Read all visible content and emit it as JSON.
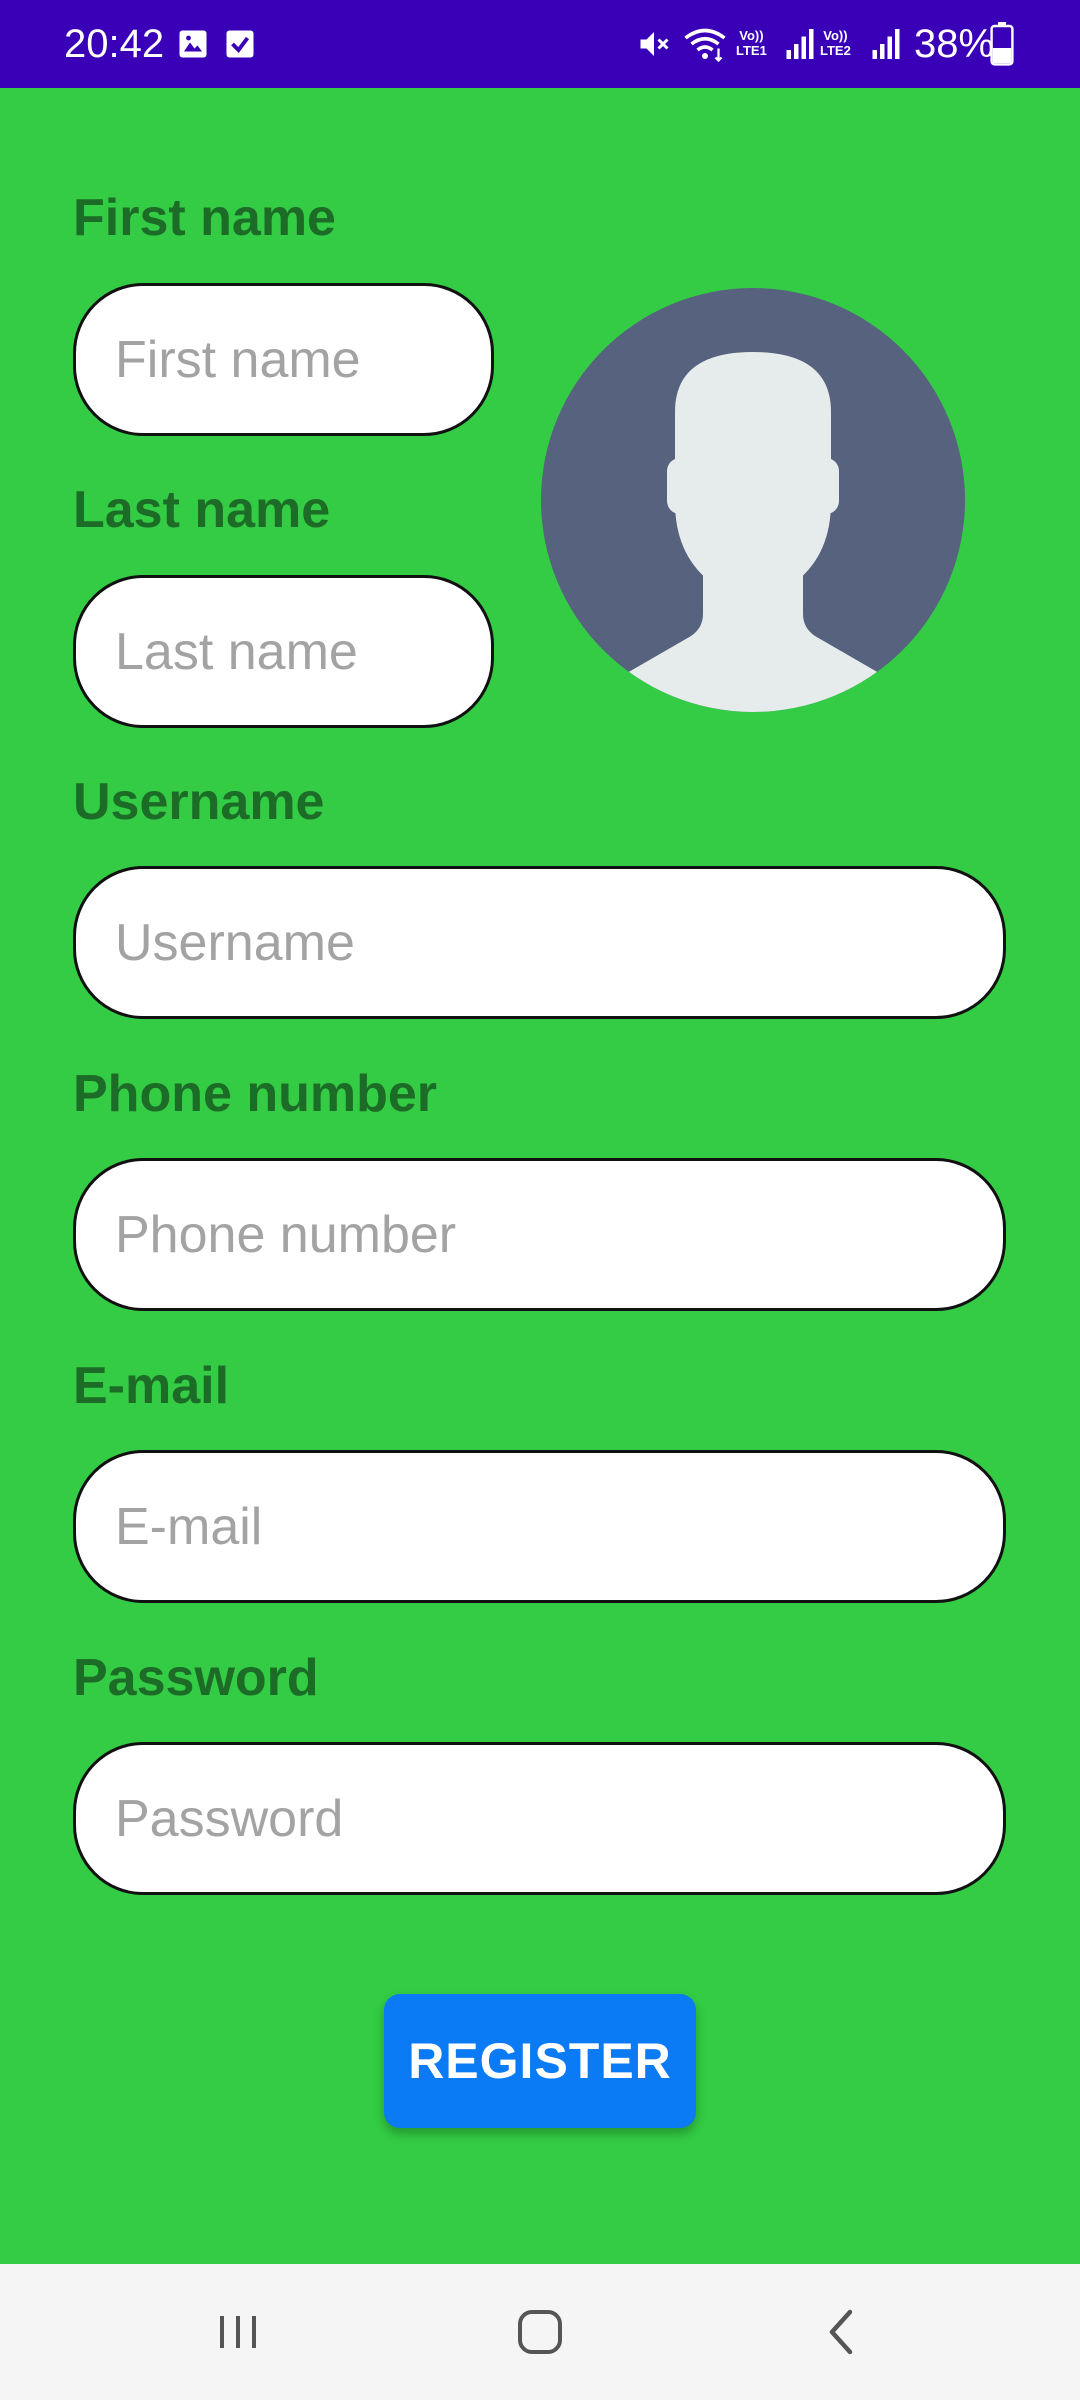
{
  "status_bar": {
    "time": "20:42",
    "battery": "38%",
    "icons": [
      "image-icon",
      "checkbox-icon",
      "mute-icon",
      "wifi-icon",
      "signal-icon",
      "signal-icon",
      "battery-icon"
    ],
    "sim1_label_top": "Vo))",
    "sim1_label_bottom": "LTE1",
    "sim2_label_top": "Vo))",
    "sim2_label_bottom": "LTE2",
    "background_color": "#3a00b8"
  },
  "form": {
    "background_color": "#33cc44",
    "label_color": "#1c6b26",
    "first_name": {
      "label": "First name",
      "placeholder": "First name"
    },
    "last_name": {
      "label": "Last name",
      "placeholder": "Last name"
    },
    "username": {
      "label": "Username",
      "placeholder": "Username"
    },
    "phone": {
      "label": "Phone number",
      "placeholder": "Phone number"
    },
    "email": {
      "label": "E-mail",
      "placeholder": "E-mail"
    },
    "password": {
      "label": "Password",
      "placeholder": "Password"
    }
  },
  "avatar": {
    "icon": "user-avatar-icon"
  },
  "register_button": {
    "label": "REGISTER",
    "color": "#0a7bf4"
  },
  "nav_bar": {
    "icons": [
      "recent-apps-icon",
      "home-icon",
      "back-icon"
    ]
  }
}
